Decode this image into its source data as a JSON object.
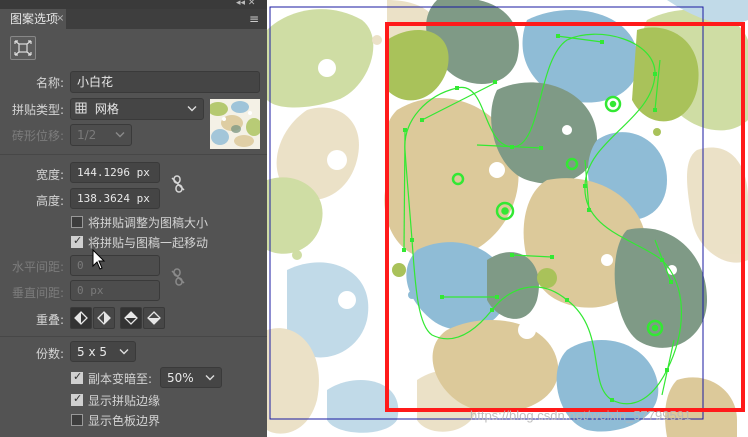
{
  "panel": {
    "title": "图案选项",
    "tab_close": "×",
    "menu": "≡",
    "top_controls": "◂◂  ✕",
    "name_label": "名称:",
    "name_value": "小白花",
    "tile_type_label": "拼贴类型:",
    "tile_type_value": "网格",
    "brick_offset_label": "砖形位移:",
    "brick_offset_value": "1/2",
    "width_label": "宽度:",
    "width_value": "144.1296 px",
    "height_label": "高度:",
    "height_value": "138.3624 px",
    "opt_resize_tile": "将拼贴调整为图稿大小",
    "opt_move_tile": "将拼贴与图稿一起移动",
    "h_spacing_label": "水平间距:",
    "h_spacing_value": "0",
    "v_spacing_label": "垂直间距:",
    "v_spacing_value": "0 px",
    "overlap_label": "重叠:",
    "copies_label": "份数:",
    "copies_value": "5 x 5",
    "dim_copies_label": "副本变暗至:",
    "dim_copies_value": "50%",
    "show_tile_edge": "显示拼贴边缘",
    "show_swatch_bounds": "显示色板边界",
    "checks": {
      "resize_tile": false,
      "move_tile": true,
      "dim_copies": true,
      "show_tile_edge": true,
      "show_swatch_bounds": false
    }
  },
  "canvas": {
    "watermark": "https://blog.csdn.net/weixin_57799591",
    "colors": {
      "green": "#a9c25a",
      "blue": "#8fbcd6",
      "tan": "#dcc99a",
      "overlap": "#7f9a86",
      "tile_edge": "#ff1a1a",
      "path": "#33e833",
      "swatch_bounds": "#1a1aa0"
    }
  },
  "icons": {
    "fit_tile": "fit-to-tile-icon",
    "grid": "grid-icon",
    "link": "chain-link-icon",
    "overlap_left": "overlap-left-front-icon",
    "overlap_right": "overlap-right-front-icon",
    "overlap_top": "overlap-top-front-icon",
    "overlap_bottom": "overlap-bottom-front-icon",
    "cursor": "mouse-pointer-icon"
  }
}
